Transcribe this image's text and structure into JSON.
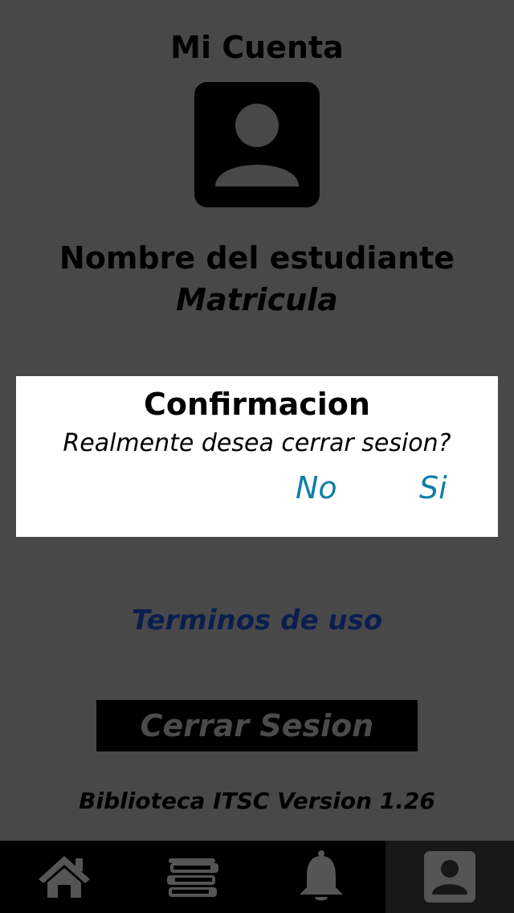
{
  "header": {
    "title": "Mi Cuenta"
  },
  "profile": {
    "avatar_icon": "person-icon",
    "name": "Nombre del estudiante",
    "matricula": "Matricula"
  },
  "dialog": {
    "title": "Confirmacion",
    "message": "Realmente desea cerrar sesion?",
    "no_label": "No",
    "yes_label": "Si",
    "button_color": "#0f7ea6"
  },
  "links": {
    "terms": "Terminos de uso"
  },
  "actions": {
    "logout_label": "Cerrar Sesion"
  },
  "footer": {
    "version": "Biblioteca ITSC Version 1.26"
  },
  "tabbar": {
    "tabs": [
      {
        "icon": "home-icon",
        "active": false
      },
      {
        "icon": "books-icon",
        "active": false
      },
      {
        "icon": "bell-icon",
        "active": false
      },
      {
        "icon": "account-icon",
        "active": true
      }
    ]
  },
  "colors": {
    "overlay_background": "#484848",
    "dialog_background": "#ffffff",
    "link_color": "#0a1f4f",
    "tabbar_background": "#000000"
  }
}
